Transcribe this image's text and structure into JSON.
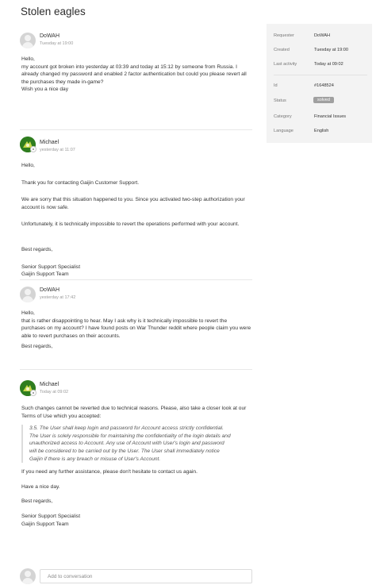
{
  "ticket": {
    "title": "Stolen eagles"
  },
  "messages": [
    {
      "author": "DoWAH",
      "time": "Tuesday at 19:00",
      "avatar": "user-icon",
      "paragraphs": [
        "Hello,",
        "my account got broken into yesterday at 03:39 and today at 15:12 by someone from Russia. I already changed my password and enabled 2 factor authentication but could you please revert all the purchases they made in-game?",
        "Wish you a nice day"
      ]
    },
    {
      "author": "Michael",
      "time": "yesterday at 11:07",
      "avatar": "agent-icon",
      "paragraphs": [
        "Hello,",
        "Thank you for contacting Gaijin Customer Support.",
        "We are sorry that this situation happened to you. Since you activated two-step authorization your account is now safe.",
        "Unfortunately, it is technically impossible to revert the operations performed with your account.",
        "Best regards,",
        "Senior Support Specialist",
        "Gaijin Support Team"
      ]
    },
    {
      "author": "DoWAH",
      "time": "yesterday at 17:42",
      "avatar": "user-icon",
      "paragraphs": [
        "Hello,",
        "that is rather disappointing to hear. May I ask why is it technically impossible to revert the purchases on my account? I have found posts on War Thunder reddit where people claim you were able to revert purchases on their accounts.",
        "Best regards,"
      ]
    },
    {
      "author": "Michael",
      "time": "Today at 09:02",
      "avatar": "agent-icon",
      "paragraphs": [
        "Such changes cannot be reverted due to technical reasons. Please, also take a closer look at our Terms of Use which you accepted:",
        "3.5. The User shall keep login and password for Account access strictly confidential. The User is solely responsible for maintaining the confidentiality of the login details and unauthorized access to Account. Any use of Account with User's login and password will be considered to be carried out by the User. The User shall immediately notice Gaijin if there is any breach or misuse of User's Account.",
        "If you need any further assistance, please don't hesitate to contact us again.",
        "Have a nice day.",
        "Best regards,",
        "Senior Support Specialist",
        "Gaijin Support Team"
      ]
    }
  ],
  "sidebar": {
    "requester_label": "Requester",
    "requester": "DoWAH",
    "created_label": "Created",
    "created": "Tuesday at 19:00",
    "last_activity_label": "Last activity",
    "last_activity": "Today at 09:02",
    "id_label": "Id",
    "id": "#1648524",
    "status_label": "Status",
    "status": "solved",
    "category_label": "Category",
    "category": "Financial Issues",
    "language_label": "Language",
    "language": "English"
  },
  "compose": {
    "placeholder": "Add to conversation"
  },
  "colors": {
    "status_badge": "#a0a0a0",
    "sidebar_bg": "#f3f3f3",
    "agent_avatar": "#2f7d1f"
  }
}
